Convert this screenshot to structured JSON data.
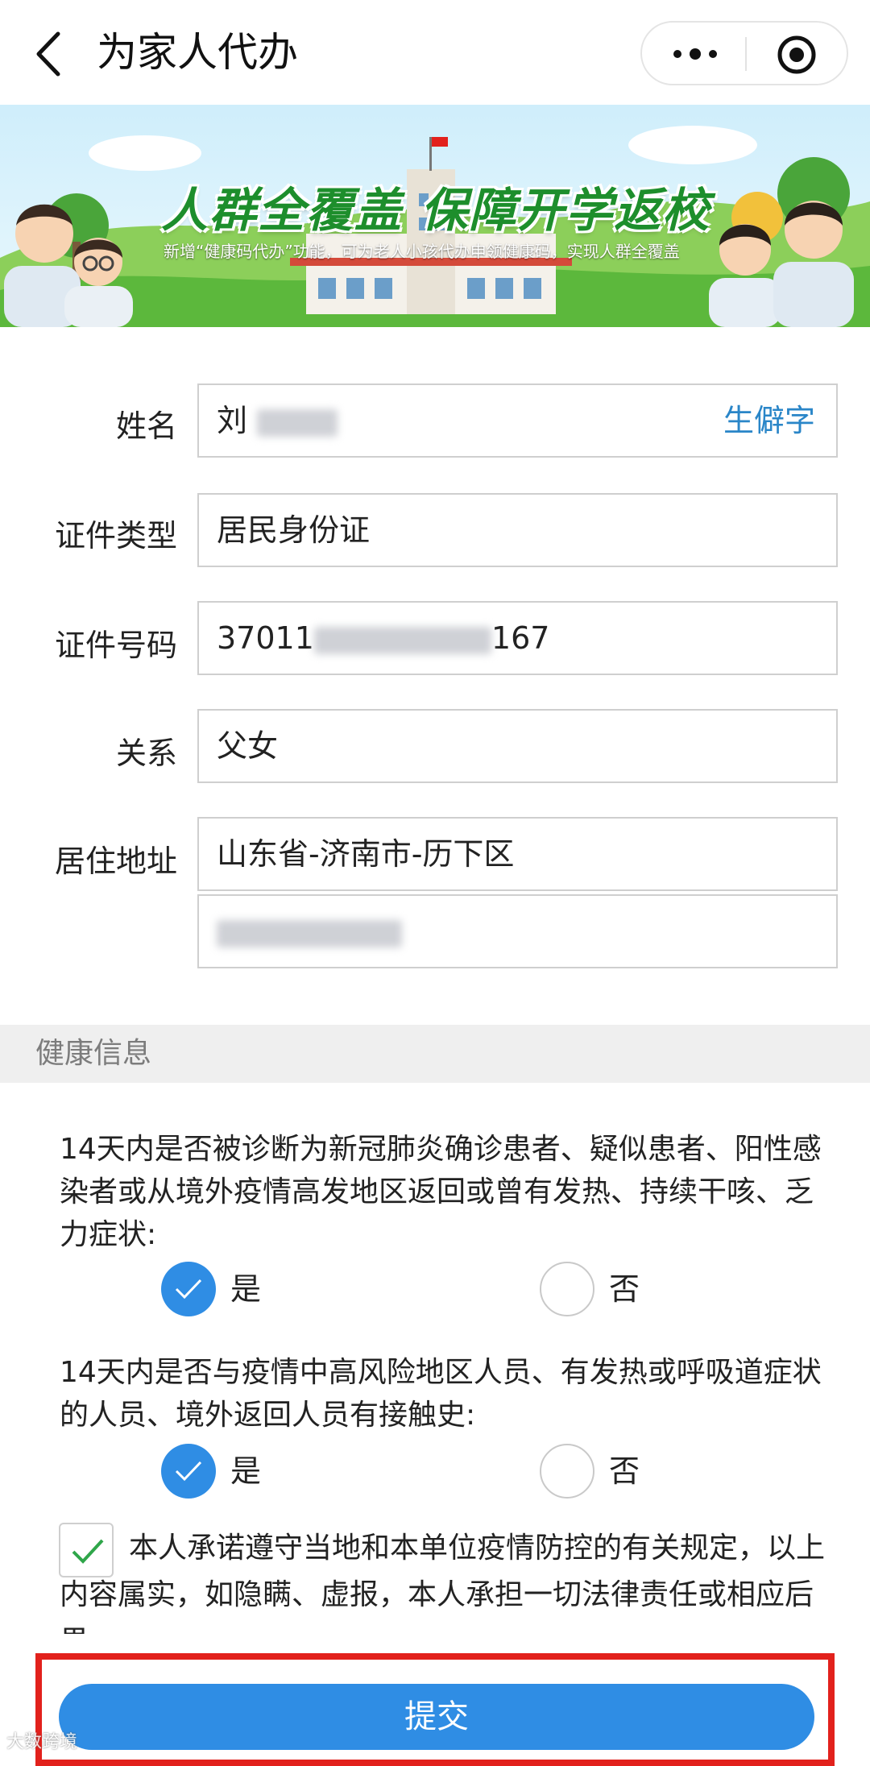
{
  "nav": {
    "title": "为家人代办",
    "back_icon": "chevron-left-icon",
    "more_icon": "more-dots-icon",
    "close_icon": "miniprogram-close-icon"
  },
  "banner": {
    "title": "人群全覆盖  保障开学返校",
    "subtitle": "新增“健康码代办”功能，可为老人小孩代办申领健康码，实现人群全覆盖"
  },
  "form": {
    "name": {
      "label": "姓名",
      "value": "刘",
      "side_link": "生僻字"
    },
    "id_type": {
      "label": "证件类型",
      "value": "居民身份证"
    },
    "id_number": {
      "label": "证件号码",
      "value_prefix": "37011",
      "value_suffix": "167"
    },
    "relation": {
      "label": "关系",
      "value": "父女"
    },
    "address": {
      "label": "居住地址",
      "region": "山东省-济南市-历下区",
      "detail": ""
    }
  },
  "health": {
    "section_title": "健康信息",
    "questions": [
      {
        "text": "14天内是否被诊断为新冠肺炎确诊患者、疑似患者、阳性感染者或从境外疫情高发地区返回或曾有发热、持续干咳、乏力症状:",
        "yes_label": "是",
        "no_label": "否",
        "selected": "是"
      },
      {
        "text": "14天内是否与疫情中高风险地区人员、有发热或呼吸道症状的人员、境外返回人员有接触史:",
        "yes_label": "是",
        "no_label": "否",
        "selected": "是"
      }
    ],
    "commitment": {
      "checked": true,
      "text": "本人承诺遵守当地和本单位疫情防控的有关规定，以上内容属实，如隐瞒、虚报，本人承担一切法律责任或相应后果。"
    }
  },
  "submit": {
    "label": "提交"
  },
  "watermark": "大数跨境",
  "colors": {
    "primary": "#2f8de4",
    "highlight": "#e2211c",
    "link": "#2a86c8",
    "banner_green": "#1d8e2c"
  }
}
